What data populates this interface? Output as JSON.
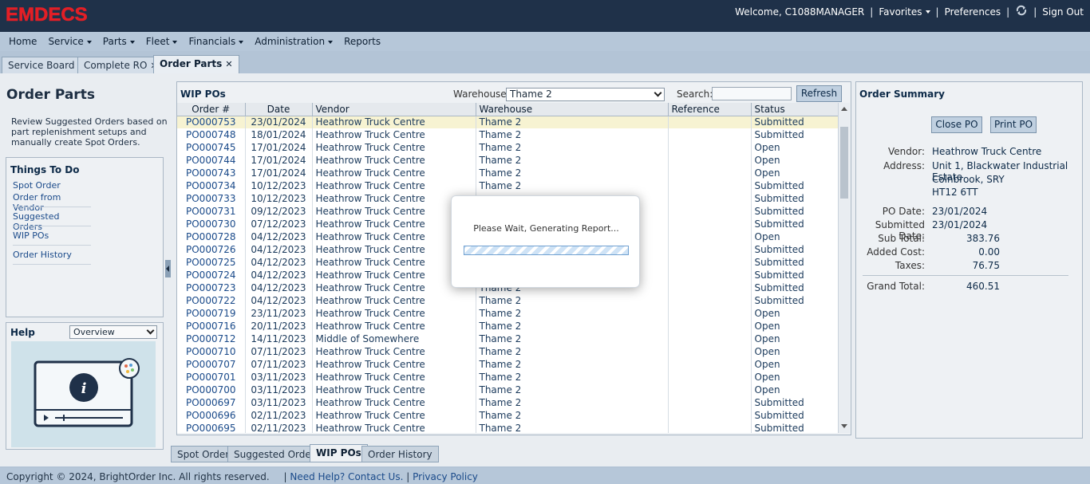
{
  "header": {
    "logo": "EMDECS",
    "welcome": "Welcome, C1088MANAGER",
    "favorites": "Favorites",
    "preferences": "Preferences",
    "sign_out": "Sign Out"
  },
  "menu": [
    {
      "label": "Home",
      "dropdown": false
    },
    {
      "label": "Service",
      "dropdown": true
    },
    {
      "label": "Parts",
      "dropdown": true
    },
    {
      "label": "Fleet",
      "dropdown": true
    },
    {
      "label": "Financials",
      "dropdown": true
    },
    {
      "label": "Administration",
      "dropdown": true
    },
    {
      "label": "Reports",
      "dropdown": false
    }
  ],
  "tabs": [
    {
      "label": "Service Board",
      "active": false
    },
    {
      "label": "Complete RO",
      "active": false
    },
    {
      "label": "Order Parts",
      "active": true
    }
  ],
  "left": {
    "title": "Order Parts",
    "description": "Review Suggested Orders based on part replenishment setups and manually create Spot Orders.",
    "todo_title": "Things To Do",
    "todo_links": [
      "Spot Order",
      "Order from Vendor",
      "Suggested Orders",
      "WIP POs",
      "Order History"
    ],
    "help_title": "Help",
    "help_select": "Overview"
  },
  "wip": {
    "title": "WIP POs",
    "warehouse_label": "Warehouse:",
    "warehouse_value": "Thame 2",
    "search_label": "Search:",
    "search_value": "",
    "refresh_label": "Refresh",
    "columns": [
      "Order #",
      "Date",
      "Vendor",
      "Warehouse",
      "Reference",
      "Status"
    ],
    "rows": [
      [
        "PO000753",
        "23/01/2024",
        "Heathrow Truck Centre",
        "Thame 2",
        "",
        "Submitted"
      ],
      [
        "PO000748",
        "18/01/2024",
        "Heathrow Truck Centre",
        "Thame 2",
        "",
        "Submitted"
      ],
      [
        "PO000745",
        "17/01/2024",
        "Heathrow Truck Centre",
        "Thame 2",
        "",
        "Open"
      ],
      [
        "PO000744",
        "17/01/2024",
        "Heathrow Truck Centre",
        "Thame 2",
        "",
        "Open"
      ],
      [
        "PO000743",
        "17/01/2024",
        "Heathrow Truck Centre",
        "Thame 2",
        "",
        "Open"
      ],
      [
        "PO000734",
        "10/12/2023",
        "Heathrow Truck Centre",
        "Thame 2",
        "",
        "Submitted"
      ],
      [
        "PO000733",
        "10/12/2023",
        "Heathrow Truck Centre",
        "",
        "",
        "Submitted"
      ],
      [
        "PO000731",
        "09/12/2023",
        "Heathrow Truck Centre",
        "",
        "",
        "Submitted"
      ],
      [
        "PO000730",
        "07/12/2023",
        "Heathrow Truck Centre",
        "",
        "",
        "Submitted"
      ],
      [
        "PO000728",
        "04/12/2023",
        "Heathrow Truck Centre",
        "",
        "",
        "Open"
      ],
      [
        "PO000726",
        "04/12/2023",
        "Heathrow Truck Centre",
        "",
        "",
        "Submitted"
      ],
      [
        "PO000725",
        "04/12/2023",
        "Heathrow Truck Centre",
        "",
        "",
        "Submitted"
      ],
      [
        "PO000724",
        "04/12/2023",
        "Heathrow Truck Centre",
        "",
        "",
        "Submitted"
      ],
      [
        "PO000723",
        "04/12/2023",
        "Heathrow Truck Centre",
        "Thame 2",
        "",
        "Submitted"
      ],
      [
        "PO000722",
        "04/12/2023",
        "Heathrow Truck Centre",
        "Thame 2",
        "",
        "Submitted"
      ],
      [
        "PO000719",
        "23/11/2023",
        "Heathrow Truck Centre",
        "Thame 2",
        "",
        "Open"
      ],
      [
        "PO000716",
        "20/11/2023",
        "Heathrow Truck Centre",
        "Thame 2",
        "",
        "Open"
      ],
      [
        "PO000712",
        "14/11/2023",
        "Middle of Somewhere",
        "Thame 2",
        "",
        "Open"
      ],
      [
        "PO000710",
        "07/11/2023",
        "Heathrow Truck Centre",
        "Thame 2",
        "",
        "Open"
      ],
      [
        "PO000707",
        "07/11/2023",
        "Heathrow Truck Centre",
        "Thame 2",
        "",
        "Open"
      ],
      [
        "PO000701",
        "03/11/2023",
        "Heathrow Truck Centre",
        "Thame 2",
        "",
        "Open"
      ],
      [
        "PO000700",
        "03/11/2023",
        "Heathrow Truck Centre",
        "Thame 2",
        "",
        "Open"
      ],
      [
        "PO000697",
        "03/11/2023",
        "Heathrow Truck Centre",
        "Thame 2",
        "",
        "Submitted"
      ],
      [
        "PO000696",
        "02/11/2023",
        "Heathrow Truck Centre",
        "Thame 2",
        "",
        "Submitted"
      ],
      [
        "PO000695",
        "02/11/2023",
        "Heathrow Truck Centre",
        "Thame 2",
        "",
        "Submitted"
      ]
    ]
  },
  "bottom_tabs": [
    {
      "label": "Spot Order",
      "active": false
    },
    {
      "label": "Suggested Orders",
      "active": false
    },
    {
      "label": "WIP POs",
      "active": true
    },
    {
      "label": "Order History",
      "active": false
    }
  ],
  "summary": {
    "title": "Order Summary",
    "close_po": "Close PO",
    "print_po": "Print PO",
    "vendor_label": "Vendor:",
    "vendor": "Heathrow Truck Centre",
    "address_label": "Address:",
    "address_lines": [
      "Unit 1, Blackwater Industrial Estate",
      "Colnbrook, SRY",
      "HT12 6TT"
    ],
    "po_date_label": "PO Date:",
    "po_date": "23/01/2024",
    "submitted_date_label": "Submitted Date:",
    "submitted_date": "23/01/2024",
    "sub_total_label": "Sub Total:",
    "sub_total": "383.76",
    "added_cost_label": "Added Cost:",
    "added_cost": "0.00",
    "taxes_label": "Taxes:",
    "taxes": "76.75",
    "grand_total_label": "Grand Total:",
    "grand_total": "460.51"
  },
  "dialog": {
    "message": "Please Wait, Generating Report...",
    "progress": 1.0
  },
  "footer": {
    "copyright": "Copyright © 2024, BrightOrder Inc. All rights reserved.",
    "help_link": "Need Help? Contact Us.",
    "privacy_link": "Privacy Policy"
  },
  "colors": {
    "topbar": "#1f3149",
    "logo": "#e21f26",
    "link": "#1a4a8a",
    "selected_row": "#f7f3d2"
  }
}
